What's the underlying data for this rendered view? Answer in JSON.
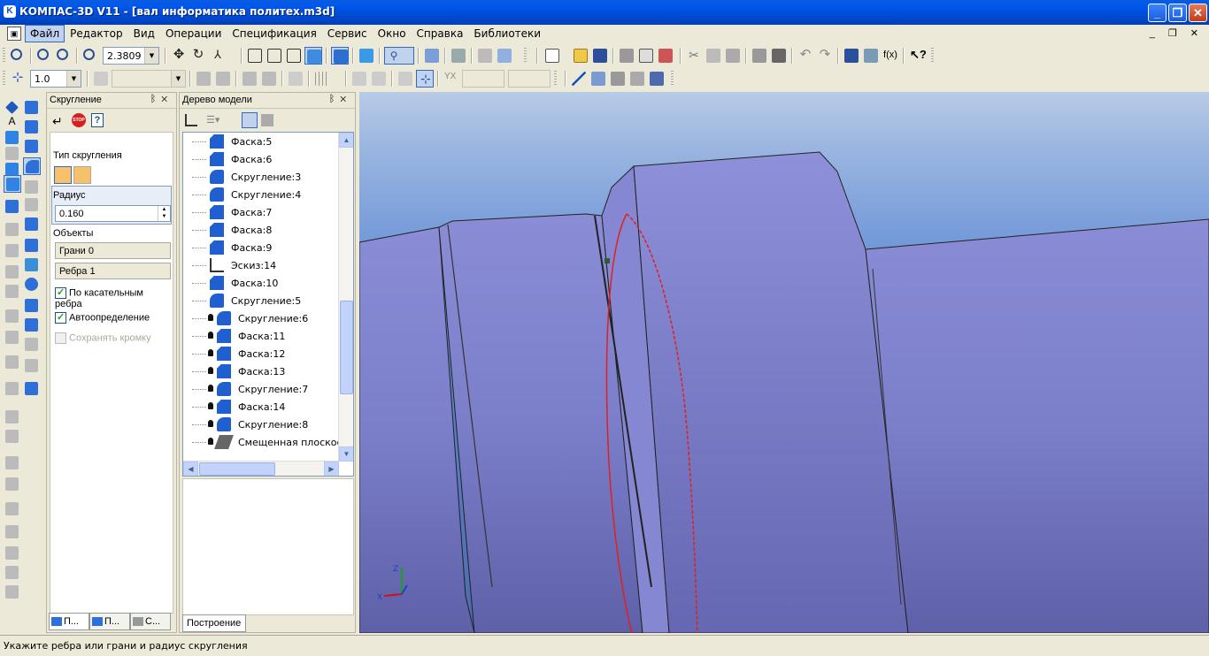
{
  "window": {
    "title": "КОМПАС-3D V11 - [вал информатика политех.m3d]",
    "app_icon": "kompas-logo-icon",
    "minimize_glyph": "_",
    "maximize_glyph": "❐",
    "close_glyph": "✕"
  },
  "menu": {
    "items": [
      "Файл",
      "Редактор",
      "Вид",
      "Операции",
      "Спецификация",
      "Сервис",
      "Окно",
      "Справка",
      "Библиотеки"
    ],
    "active": "Файл",
    "doc_controls": "_ ❐ ✕"
  },
  "toolbar_main": {
    "zoom_value": "2.3809"
  },
  "toolbar_current": {
    "step_value": "1.0"
  },
  "property_panel": {
    "title": "Скругление",
    "fillet_type_label": "Тип скругления",
    "radius_label": "Радиус",
    "radius_value": "0.160",
    "objects_label": "Объекты",
    "faces_value": "Грани 0",
    "edges_value": "Ребра 1",
    "tangent_edges_label": "По касательным ребра",
    "tangent_edges_checked": true,
    "auto_detect_label": "Автоопределение",
    "auto_detect_checked": true,
    "keep_edge_label": "Сохранять кромку",
    "keep_edge_checked": false,
    "tabs": [
      "П...",
      "П...",
      "С..."
    ],
    "pin_glyph": "ᛒ",
    "close_glyph": "✕"
  },
  "model_tree": {
    "title": "Дерево модели",
    "items": [
      {
        "label": "Фаска:5",
        "type": "chamfer",
        "locked": false
      },
      {
        "label": "Фаска:6",
        "type": "chamfer",
        "locked": false
      },
      {
        "label": "Скругление:3",
        "type": "fillet",
        "locked": false
      },
      {
        "label": "Скругление:4",
        "type": "fillet",
        "locked": false
      },
      {
        "label": "Фаска:7",
        "type": "chamfer",
        "locked": false
      },
      {
        "label": "Фаска:8",
        "type": "chamfer",
        "locked": false
      },
      {
        "label": "Фаска:9",
        "type": "chamfer",
        "locked": false
      },
      {
        "label": "Эскиз:14",
        "type": "sketch",
        "locked": false
      },
      {
        "label": "Фаска:10",
        "type": "chamfer",
        "locked": false
      },
      {
        "label": "Скругление:5",
        "type": "fillet",
        "locked": false
      },
      {
        "label": "Скругление:6",
        "type": "fillet",
        "locked": true
      },
      {
        "label": "Фаска:11",
        "type": "chamfer",
        "locked": true
      },
      {
        "label": "Фаска:12",
        "type": "chamfer",
        "locked": true
      },
      {
        "label": "Фаска:13",
        "type": "chamfer",
        "locked": true
      },
      {
        "label": "Скругление:7",
        "type": "fillet",
        "locked": true
      },
      {
        "label": "Фаска:14",
        "type": "chamfer",
        "locked": true
      },
      {
        "label": "Скругление:8",
        "type": "fillet",
        "locked": true
      },
      {
        "label": "Смещенная плоскость",
        "type": "plane",
        "locked": true
      }
    ],
    "tab_label": "Построение"
  },
  "status": {
    "message": "Укажите ребра или грани и радиус скругления"
  },
  "colors": {
    "accent": "#316AC5",
    "title_bar": "#0058EE",
    "shaft": "#7F82CE",
    "selected_edge": "#E02020"
  }
}
